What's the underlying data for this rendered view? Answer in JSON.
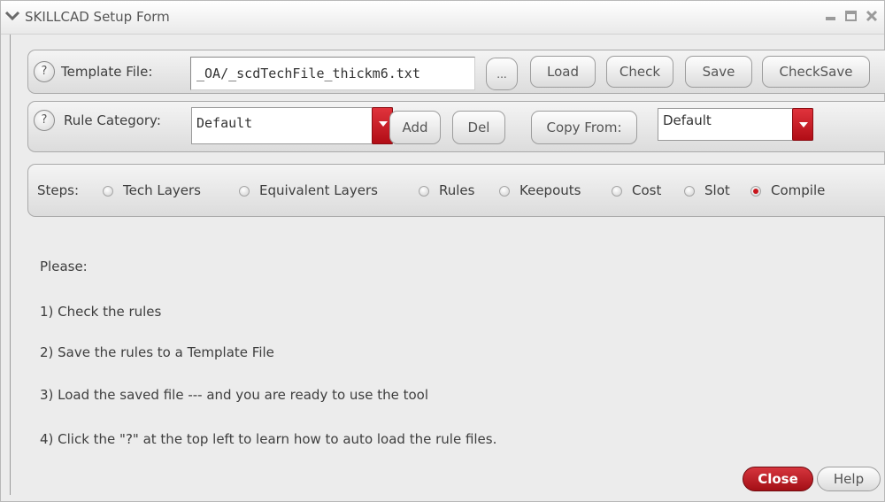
{
  "window": {
    "title": "SKILLCAD Setup Form"
  },
  "template_row": {
    "help": "?",
    "label": "Template File:",
    "value": "_OA/_scdTechFile_thickm6.txt",
    "browse_label": "...",
    "buttons": {
      "load": "Load",
      "check": "Check",
      "save": "Save",
      "checksave": "CheckSave"
    }
  },
  "rule_row": {
    "help": "?",
    "label": "Rule Category:",
    "category_value": "Default",
    "add_label": "Add",
    "del_label": "Del",
    "copy_from_label": "Copy From:",
    "copy_from_value": "Default"
  },
  "steps": {
    "label": "Steps:",
    "options": [
      {
        "label": "Tech Layers",
        "selected": false
      },
      {
        "label": "Equivalent Layers",
        "selected": false
      },
      {
        "label": "Rules",
        "selected": false
      },
      {
        "label": "Keepouts",
        "selected": false
      },
      {
        "label": "Cost",
        "selected": false
      },
      {
        "label": "Slot",
        "selected": false
      },
      {
        "label": "Compile",
        "selected": true
      }
    ]
  },
  "instructions": {
    "heading": "Please:",
    "lines": [
      "1) Check the rules",
      "2) Save the rules to a Template File",
      "3) Load the saved file --- and you are ready to use the tool",
      "4) Click the \"?\" at the top left to learn how to auto load the rule files."
    ]
  },
  "footer": {
    "close_label": "Close",
    "help_label": "Help"
  },
  "colors": {
    "accent_red": "#c8151c",
    "panel_bg": "#ececec"
  }
}
